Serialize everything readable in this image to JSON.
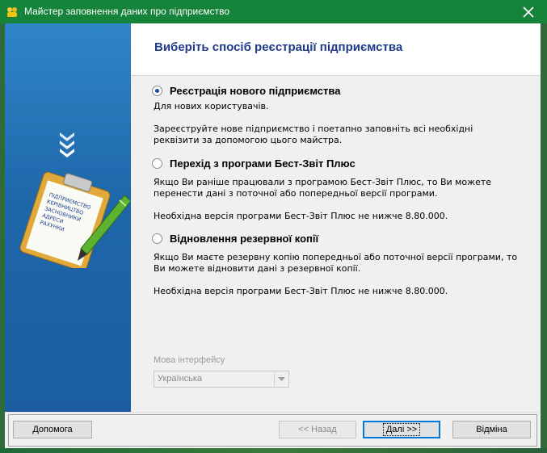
{
  "window": {
    "title": "Майстер заповнення даних про підприємство"
  },
  "header": {
    "heading": "Виберіть спосіб реєстрації підприємства"
  },
  "options": [
    {
      "label": "Реєстрація нового підприємства",
      "selected": true,
      "desc": "Для нових користувачів.\n\nЗареєструйте нове підприємство і поетапно заповніть всі необхідні\nреквізити за допомогою цього майстра."
    },
    {
      "label": "Перехід з програми Бест-Звіт Плюс",
      "selected": false,
      "desc": "Якщо Ви раніше працювали з програмою Бест-Звіт Плюс, то Ви можете\nперенести дані з поточної або попередньої версії програми.\n\nНеобхідна версія програми Бест-Звіт Плюс не нижче 8.80.000."
    },
    {
      "label": "Відновлення резервної копії",
      "selected": false,
      "desc": "Якщо Ви маєте резервну копію попередньої або поточної версії програми, то\nВи можете відновити дані з резервної копії.\n\nНеобхідна версія програми Бест-Звіт Плюс не нижче 8.80.000."
    }
  ],
  "language": {
    "label": "Мова інтерфейсу",
    "value": "Українська"
  },
  "clipboard_lines": [
    "ПІДПРИЄМСТВО",
    "КЕРІВНИЦТВО",
    "ЗАСНОВНИКИ",
    "АДРЕСИ",
    "РАХУНКИ"
  ],
  "buttons": {
    "help": "Допомога",
    "back": "<< Назад",
    "next": "Далі >>",
    "cancel": "Відміна"
  },
  "colors": {
    "titlebar": "#16833a",
    "heading": "#213a8a",
    "sidebar": "#1e67ab"
  }
}
